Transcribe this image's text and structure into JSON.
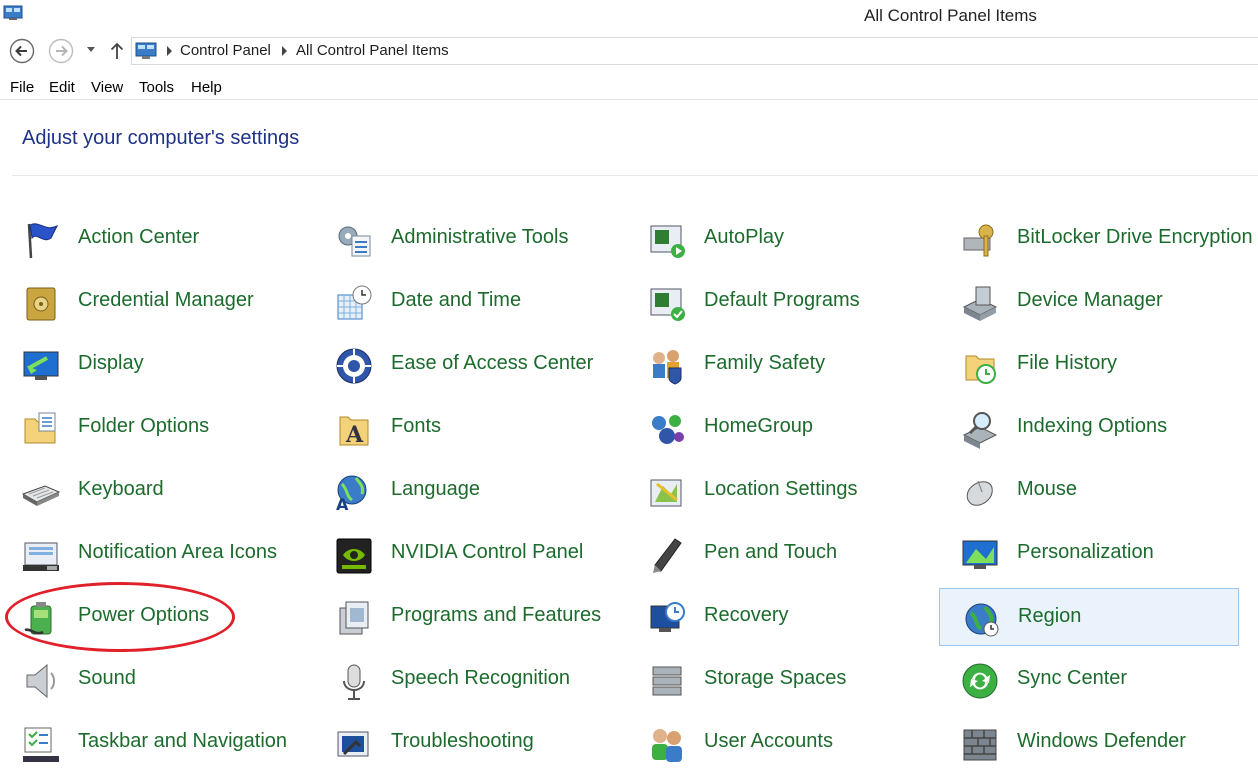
{
  "window": {
    "title": "All Control Panel Items"
  },
  "breadcrumb": [
    "Control Panel",
    "All Control Panel Items"
  ],
  "menu": [
    "File",
    "Edit",
    "View",
    "Tools",
    "Help"
  ],
  "heading": "Adjust your computer's settings",
  "colors": {
    "link": "#1c6b2d",
    "heading": "#1e3287",
    "highlight_circle": "#e0202a",
    "selection": "#eaf3fc"
  },
  "items": [
    {
      "label": "Action Center",
      "icon": "flag-icon"
    },
    {
      "label": "Administrative Tools",
      "icon": "admin-tools-icon"
    },
    {
      "label": "AutoPlay",
      "icon": "autoplay-icon"
    },
    {
      "label": "BitLocker Drive Encryption",
      "icon": "bitlocker-key-icon"
    },
    {
      "label": "Credential Manager",
      "icon": "vault-icon"
    },
    {
      "label": "Date and Time",
      "icon": "calendar-clock-icon"
    },
    {
      "label": "Default Programs",
      "icon": "default-programs-icon"
    },
    {
      "label": "Device Manager",
      "icon": "device-manager-icon"
    },
    {
      "label": "Display",
      "icon": "monitor-icon"
    },
    {
      "label": "Ease of Access Center",
      "icon": "ease-of-access-icon"
    },
    {
      "label": "Family Safety",
      "icon": "family-icon"
    },
    {
      "label": "File History",
      "icon": "file-history-icon"
    },
    {
      "label": "Folder Options",
      "icon": "folder-options-icon"
    },
    {
      "label": "Fonts",
      "icon": "fonts-icon"
    },
    {
      "label": "HomeGroup",
      "icon": "homegroup-icon"
    },
    {
      "label": "Indexing Options",
      "icon": "indexing-icon"
    },
    {
      "label": "Keyboard",
      "icon": "keyboard-icon"
    },
    {
      "label": "Language",
      "icon": "language-icon"
    },
    {
      "label": "Location Settings",
      "icon": "location-icon"
    },
    {
      "label": "Mouse",
      "icon": "mouse-icon"
    },
    {
      "label": "Notification Area Icons",
      "icon": "notification-tray-icon"
    },
    {
      "label": "NVIDIA Control Panel",
      "icon": "nvidia-icon"
    },
    {
      "label": "Pen and Touch",
      "icon": "pen-icon"
    },
    {
      "label": "Personalization",
      "icon": "personalization-icon"
    },
    {
      "label": "Power Options",
      "icon": "battery-icon"
    },
    {
      "label": "Programs and Features",
      "icon": "programs-icon"
    },
    {
      "label": "Recovery",
      "icon": "recovery-icon"
    },
    {
      "label": "Region",
      "icon": "globe-clock-icon",
      "selected": true
    },
    {
      "label": "Sound",
      "icon": "speaker-icon"
    },
    {
      "label": "Speech Recognition",
      "icon": "microphone-icon"
    },
    {
      "label": "Storage Spaces",
      "icon": "storage-spaces-icon"
    },
    {
      "label": "Sync Center",
      "icon": "sync-icon"
    },
    {
      "label": "Taskbar and Navigation",
      "icon": "taskbar-icon"
    },
    {
      "label": "Troubleshooting",
      "icon": "troubleshooting-icon"
    },
    {
      "label": "User Accounts",
      "icon": "users-icon"
    },
    {
      "label": "Windows Defender",
      "icon": "wall-icon"
    }
  ]
}
